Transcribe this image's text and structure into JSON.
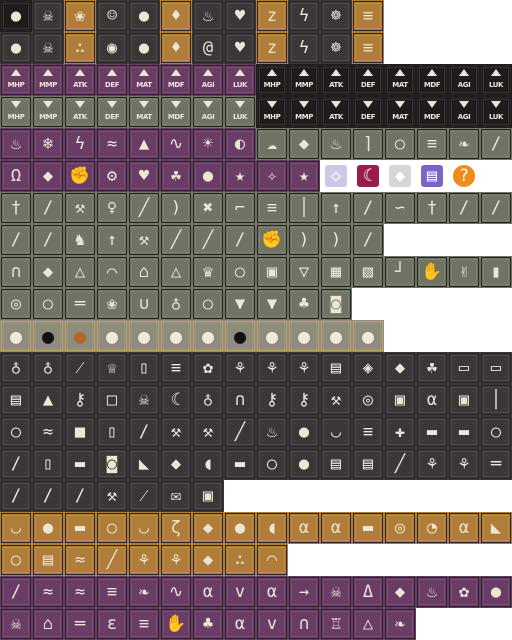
{
  "sheet": {
    "palette": {
      "dark": "#3b3637",
      "darker": "#1f1b1c",
      "olive": "#6f7562",
      "tan": "#b07d3a",
      "purple": "#6a3d66",
      "blue_purple": "#5f5f8a",
      "gray": "#8d8c7d",
      "frame_gold": "#c7a65b",
      "glyph_light": "#ece6d2"
    },
    "rows": [
      {
        "count": 12,
        "style": "dark",
        "icons": [
          "void-icon",
          "skull-icon",
          "gear-swirl-icon",
          "grin-icon",
          "bubble-icon",
          "demon-icon",
          "fire-icon",
          "heart-break-icon",
          "sleep-icon",
          "lightning-icon",
          "spider-icon",
          "claw-icon"
        ]
      },
      {
        "count": 12,
        "style": "dark",
        "icons": [
          "void-icon",
          "skull-icon",
          "spores-icon",
          "mask-icon",
          "bubble-icon",
          "demon-icon",
          "swirl-icon",
          "heart-break-icon",
          "sleep-icon",
          "lightning-icon",
          "spider-icon",
          "claw-icon"
        ]
      },
      {
        "count": 16,
        "style": "stat_up",
        "labels": [
          "MHP",
          "MMP",
          "ATK",
          "DEF",
          "MAT",
          "MDF",
          "AGI",
          "LUK",
          "MHP",
          "MMP",
          "ATK",
          "DEF",
          "MAT",
          "MDF",
          "AGI",
          "LUK"
        ]
      },
      {
        "count": 16,
        "style": "stat_down",
        "labels": [
          "MHP",
          "MMP",
          "ATK",
          "DEF",
          "MAT",
          "MDF",
          "AGI",
          "LUK",
          "MHP",
          "MMP",
          "ATK",
          "DEF",
          "MAT",
          "MDF",
          "AGI",
          "LUK"
        ]
      },
      {
        "count": 16,
        "style": "element",
        "icons": [
          "fire-icon",
          "ice-icon",
          "thunder-icon",
          "water-icon",
          "earth-icon",
          "wind-icon",
          "light-icon",
          "dark-icon",
          "cloud-icon",
          "shield-icon",
          "fire-icon",
          "chevron-icon",
          "ring-icon",
          "claw-icon",
          "feather-icon",
          "sword-icon"
        ]
      },
      {
        "count": 15,
        "style": "misc",
        "icons": [
          "bell-icon",
          "shield-icon",
          "fist-icon",
          "gear-icon",
          "heart-icon",
          "leaf-icon",
          "circle-icon",
          "star-icon",
          "sparkle-icon",
          "star-icon",
          "diamond-icon",
          "moon-icon",
          "gem-icon",
          "book-icon",
          "question-icon"
        ]
      },
      {
        "count": 16,
        "style": "weapon",
        "icons": [
          "dagger-icon",
          "sword-icon",
          "axe-icon",
          "flail-icon",
          "staff-icon",
          "bow-icon",
          "crossbow-icon",
          "gun-icon",
          "claw-icon",
          "rod-icon",
          "spear-icon",
          "blade-icon",
          "whip-icon",
          "dagger-icon",
          "sword-icon",
          "sword-icon"
        ]
      },
      {
        "count": 12,
        "style": "weapon",
        "icons": [
          "sword-icon",
          "sword-icon",
          "horse-icon",
          "spear-icon",
          "axe-icon",
          "staff-icon",
          "staff-icon",
          "sword-icon",
          "fist-icon",
          "bow-icon",
          "bow-icon",
          "sword-icon"
        ]
      },
      {
        "count": 16,
        "style": "armor",
        "icons": [
          "helmet-icon",
          "shield-icon",
          "hat-icon",
          "cap-icon",
          "hood-icon",
          "hat-icon",
          "crown-icon",
          "ring-icon",
          "armor-icon",
          "robe-icon",
          "cloth-icon",
          "vest-icon",
          "boots-icon",
          "glove-icon",
          "gauntlet-icon",
          "bracer-icon"
        ]
      },
      {
        "count": 11,
        "style": "armor",
        "icons": [
          "amulet-icon",
          "ring-icon",
          "belt-icon",
          "brooch-icon",
          "necklace-icon",
          "pendant-icon",
          "ring-icon",
          "cape-icon",
          "cape-icon",
          "charm-icon",
          "bag-icon"
        ]
      },
      {
        "count": 12,
        "style": "orb",
        "icons": [
          "orb-icon",
          "orb-icon",
          "orb-icon",
          "orb-icon",
          "orb-icon",
          "orb-icon",
          "orb-icon",
          "orb-icon",
          "orb-icon",
          "orb-icon",
          "orb-icon",
          "orb-icon"
        ]
      },
      {
        "count": 16,
        "style": "item",
        "icons": [
          "potion-icon",
          "potion-icon",
          "wand-icon",
          "trophy-icon",
          "bottle-icon",
          "scroll-icon",
          "flower-icon",
          "herb-icon",
          "herb-icon",
          "herb-icon",
          "book-icon",
          "crystal-icon",
          "gem-icon",
          "leaf-icon",
          "ticket-icon",
          "ticket-icon"
        ]
      },
      {
        "count": 16,
        "style": "item",
        "icons": [
          "card-icon",
          "pyramid-icon",
          "key-icon",
          "paper-icon",
          "skull-icon",
          "moon-icon",
          "vase-icon",
          "helmet-icon",
          "key-icon",
          "key-icon",
          "pick-icon",
          "coin-icon",
          "gift-icon",
          "fish-icon",
          "gift-icon",
          "candle-icon"
        ]
      },
      {
        "count": 16,
        "style": "item",
        "icons": [
          "egg-icon",
          "snake-icon",
          "box-icon",
          "lantern-icon",
          "sword-icon",
          "hammer-icon",
          "pickaxe-icon",
          "stick-icon",
          "torch-icon",
          "apple-icon",
          "bowl-icon",
          "scroll-icon",
          "cross-icon",
          "bread-icon",
          "bread-icon",
          "egg-icon"
        ]
      },
      {
        "count": 16,
        "style": "item",
        "icons": [
          "sword-icon",
          "mug-icon",
          "bread-icon",
          "pouch-icon",
          "cheese-icon",
          "ore-icon",
          "meat-icon",
          "bar-icon",
          "egg-icon",
          "stone-icon",
          "book-icon",
          "book-icon",
          "brush-icon",
          "plant-icon",
          "plant-icon",
          "bone-icon"
        ]
      },
      {
        "count": 7,
        "style": "item",
        "icons": [
          "sword-icon",
          "sword-icon",
          "knife-icon",
          "axe-icon",
          "wand-icon",
          "letter-icon",
          "chest-icon"
        ]
      },
      {
        "count": 16,
        "style": "food",
        "icons": [
          "soup-icon",
          "orange-icon",
          "bread-icon",
          "egg-icon",
          "dish-icon",
          "shrimp-icon",
          "sweet-icon",
          "apple-icon",
          "meat-icon",
          "fish-icon",
          "fish-icon",
          "bread-icon",
          "cookie-icon",
          "pie-icon",
          "fish-icon",
          "cheese-icon"
        ]
      },
      {
        "count": 9,
        "style": "food",
        "icons": [
          "onion-icon",
          "cake-icon",
          "noodle-icon",
          "leek-icon",
          "herb-icon",
          "herb-icon",
          "ore-icon",
          "berry-icon",
          "pudding-icon"
        ]
      },
      {
        "count": 16,
        "style": "skill",
        "icons": [
          "sword-icon",
          "snake-icon",
          "wave-icon",
          "claw-icon",
          "feather-icon",
          "wind-icon",
          "fish-icon",
          "bird-icon",
          "fish-icon",
          "arrow-icon",
          "skull-icon",
          "dragon-icon",
          "gem-icon",
          "fire-icon",
          "flower-icon",
          "orb-icon"
        ]
      },
      {
        "count": 13,
        "style": "skill",
        "icons": [
          "skull-icon",
          "ghost-icon",
          "bone-icon",
          "lobster-icon",
          "claw-icon",
          "hand-icon",
          "tree-icon",
          "fish-icon",
          "bird-icon",
          "grave-icon",
          "tower-icon",
          "lamp-icon",
          "feather-icon"
        ]
      }
    ]
  }
}
